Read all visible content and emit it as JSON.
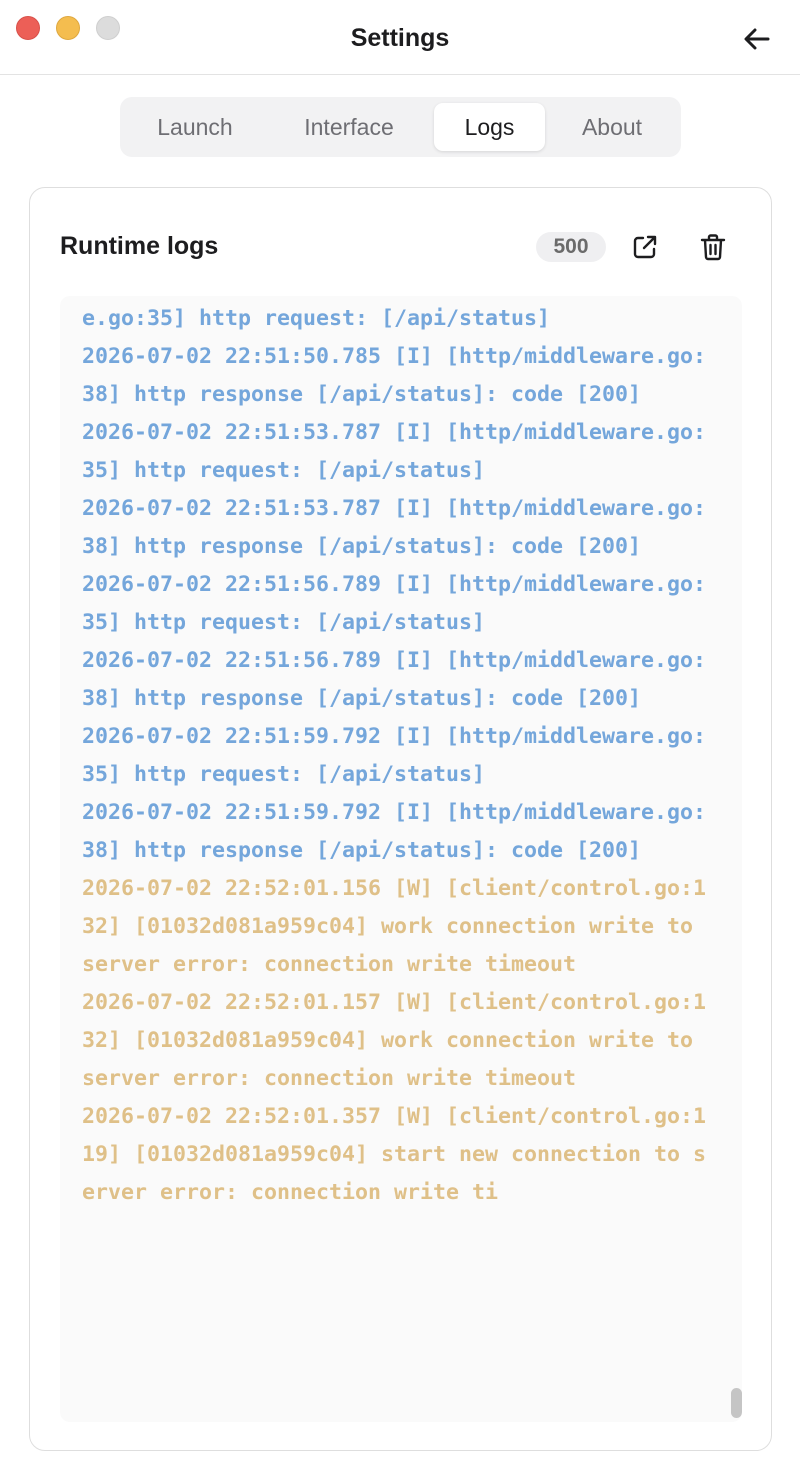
{
  "window": {
    "title": "Settings"
  },
  "tabs": [
    {
      "label": "Launch",
      "active": false
    },
    {
      "label": "Interface",
      "active": false
    },
    {
      "label": "Logs",
      "active": true
    },
    {
      "label": "About",
      "active": false
    }
  ],
  "logs_card": {
    "title": "Runtime logs",
    "count": "500"
  },
  "logs": [
    {
      "level": "info",
      "text": "e.go:35] http request: [/api/status]"
    },
    {
      "level": "info",
      "text": "2026-07-02 22:51:50.785 [I] [http/middleware.go:38] http response [/api/status]: code [200]"
    },
    {
      "level": "info",
      "text": "2026-07-02 22:51:53.787 [I] [http/middleware.go:35] http request: [/api/status]"
    },
    {
      "level": "info",
      "text": "2026-07-02 22:51:53.787 [I] [http/middleware.go:38] http response [/api/status]: code [200]"
    },
    {
      "level": "info",
      "text": "2026-07-02 22:51:56.789 [I] [http/middleware.go:35] http request: [/api/status]"
    },
    {
      "level": "info",
      "text": "2026-07-02 22:51:56.789 [I] [http/middleware.go:38] http response [/api/status]: code [200]"
    },
    {
      "level": "info",
      "text": "2026-07-02 22:51:59.792 [I] [http/middleware.go:35] http request: [/api/status]"
    },
    {
      "level": "info",
      "text": "2026-07-02 22:51:59.792 [I] [http/middleware.go:38] http response [/api/status]: code [200]"
    },
    {
      "level": "warn",
      "text": "2026-07-02 22:52:01.156 [W] [client/control.go:132] [01032d081a959c04] work connection write to server error: connection write timeout"
    },
    {
      "level": "warn",
      "text": "2026-07-02 22:52:01.157 [W] [client/control.go:132] [01032d081a959c04] work connection write to server error: connection write timeout"
    },
    {
      "level": "warn",
      "text": "2026-07-02 22:52:01.357 [W] [client/control.go:119] [01032d081a959c04] start new connection to server error: connection write ti"
    }
  ],
  "colors": {
    "info": "#74a6db",
    "warn": "#dfc088",
    "close": "#ec5f57",
    "minimize": "#f4bd4f",
    "zoom": "#dcdcdc"
  },
  "icons": {
    "back": "arrow-left-icon",
    "open_external": "external-link-icon",
    "clear": "trash-icon"
  }
}
